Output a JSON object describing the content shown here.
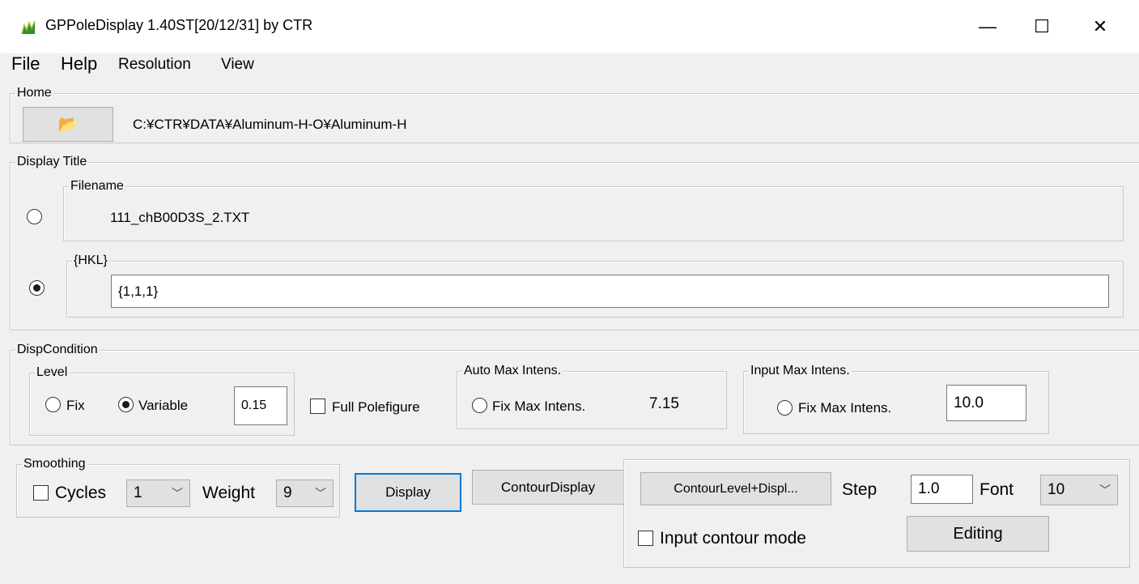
{
  "window": {
    "title": "GPPoleDisplay 1.40ST[20/12/31] by CTR",
    "minimize": "—",
    "maximize": "☐",
    "close": "✕",
    "icon": "app-icon"
  },
  "menu": [
    "File",
    "Help",
    "Resolution",
    "View"
  ],
  "home": {
    "label": "Home",
    "path": "C:¥CTR¥DATA¥Aluminum-H-O¥Aluminum-H",
    "open_icon": "📂"
  },
  "display_title": {
    "label": "Display Title",
    "filename_label": "Filename",
    "filename_value": "111_chB00D3S_2.TXT",
    "hkl_label": "{HKL}",
    "hkl_value": "{1,1,1}"
  },
  "disp_condition": {
    "label": "DispCondition",
    "level_label": "Level",
    "fix_label": "Fix",
    "variable_label": "Variable",
    "level_value": "0.15",
    "full_polefigure": "Full Polefigure",
    "auto_max_label": "Auto Max Intens.",
    "auto_fix_label": "Fix Max Intens.",
    "auto_max_value": "7.15",
    "input_max_label": "Input Max Intens.",
    "input_fix_label": "Fix Max Intens.",
    "input_max_value": "10.0"
  },
  "smoothing": {
    "label": "Smoothing",
    "cycles_label": "Cycles",
    "cycles_value": "1",
    "weight_label": "Weight",
    "weight_value": "9"
  },
  "buttons": {
    "display": "Display",
    "contour_display": "ContourDisplay",
    "contour_level": "ContourLevel+Displ...",
    "editing": "Editing"
  },
  "contour": {
    "step_label": "Step",
    "step_value": "1.0",
    "font_label": "Font",
    "font_value": "10",
    "input_mode_label": "Input contour mode"
  }
}
